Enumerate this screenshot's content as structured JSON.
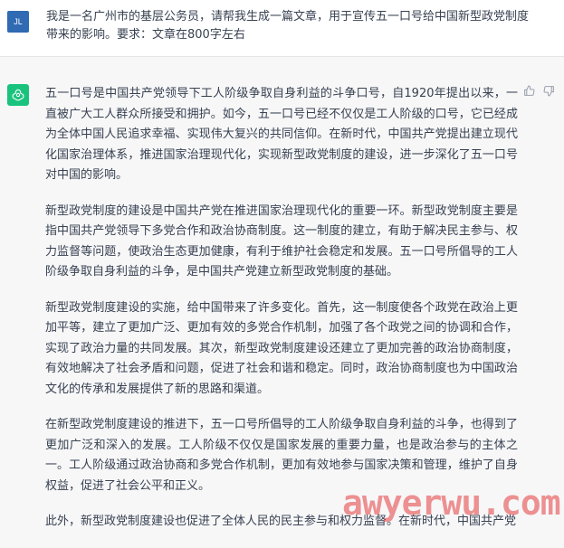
{
  "user": {
    "initials": "JL",
    "message": "我是一名广州市的基层公务员，请帮我生成一篇文章，用于宣传五一口号给中国新型政党制度带来的影响。要求：文章在800字左右"
  },
  "assistant": {
    "paragraphs": [
      "五一口号是中国共产党领导下工人阶级争取自身利益的斗争口号，自1920年提出以来，一直被广大工人群众所接受和拥护。如今，五一口号已经不仅仅是工人阶级的口号，它已经成为全体中国人民追求幸福、实现伟大复兴的共同信仰。在新时代，中国共产党提出建立现代化国家治理体系，推进国家治理现代化，实现新型政党制度的建设，进一步深化了五一口号对中国的影响。",
      "新型政党制度的建设是中国共产党在推进国家治理现代化的重要一环。新型政党制度主要是指中国共产党领导下多党合作和政治协商制度。这一制度的建立，有助于解决民主参与、权力监督等问题，使政治生态更加健康，有利于维护社会稳定和发展。五一口号所倡导的工人阶级争取自身利益的斗争，是中国共产党建立新型政党制度的基础。",
      "新型政党制度建设的实施，给中国带来了许多变化。首先，这一制度使各个政党在政治上更加平等，建立了更加广泛、更加有效的多党合作机制，加强了各个政党之间的协调和合作，实现了政治力量的共同发展。其次，新型政党制度建设还建立了更加完善的政治协商制度，有效地解决了社会矛盾和问题，促进了社会和谐和稳定。同时，政治协商制度也为中国政治文化的传承和发展提供了新的思路和渠道。",
      "在新型政党制度建设的推进下，五一口号所倡导的工人阶级争取自身利益的斗争，也得到了更加广泛和深入的发展。工人阶级不仅仅是国家发展的重要力量，也是政治参与的主体之一。工人阶级通过政治协商和多党合作机制，更加有效地参与国家决策和管理，维护了自身权益，促进了社会公平和正义。",
      "此外，新型政党制度建设也促进了全体人民的民主参与和权力监督。在新时代，中国共产党"
    ]
  },
  "icons": {
    "bot": "openai-logo-icon",
    "like": "thumbs-up-icon",
    "dislike": "thumbs-down-icon"
  },
  "colors": {
    "bot_avatar": "#19c37d",
    "user_avatar": "#2f6ab3"
  },
  "watermark": "awyerwu.com"
}
